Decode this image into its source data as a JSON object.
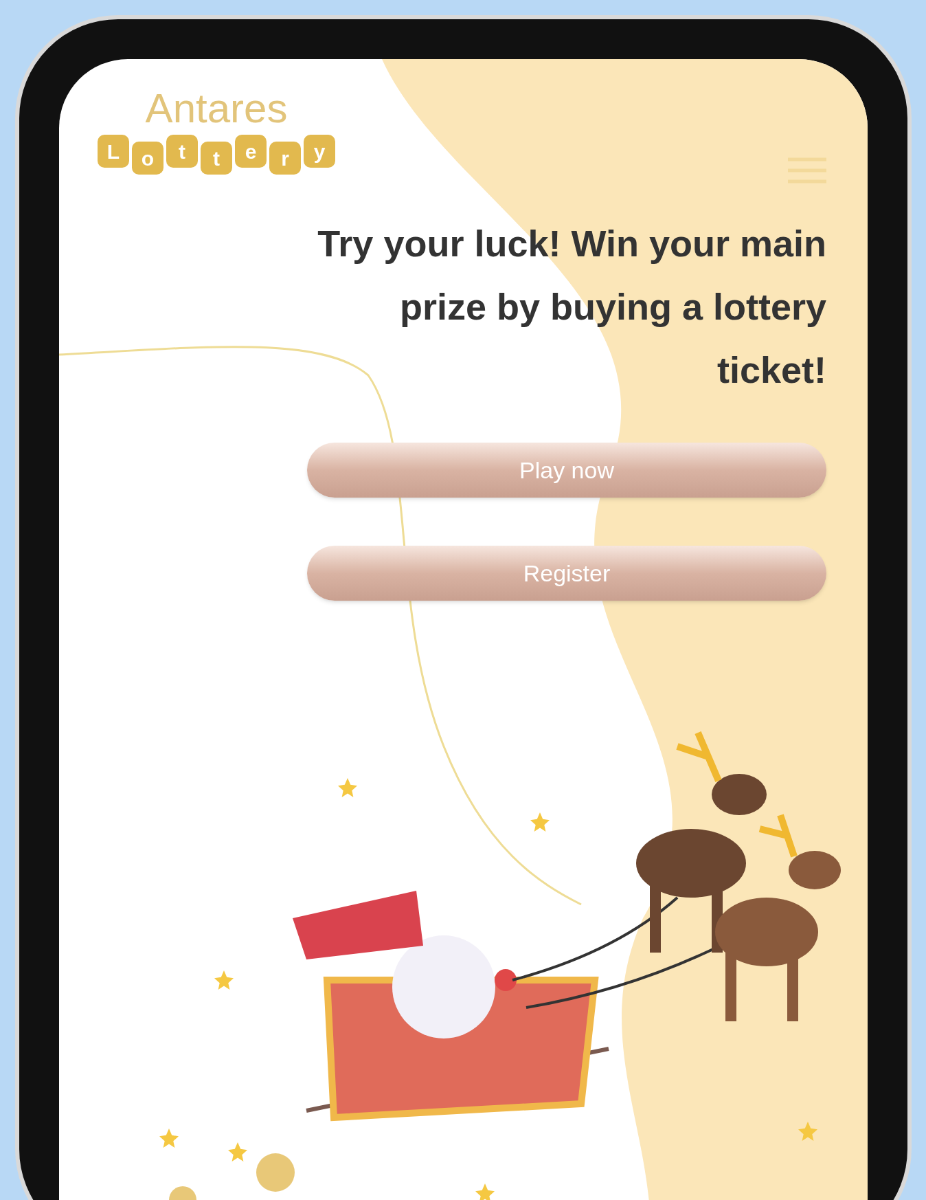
{
  "logo": {
    "name": "Antares",
    "tiles": [
      "L",
      "o",
      "t",
      "t",
      "e",
      "r",
      "y"
    ]
  },
  "hero": {
    "heading": "Try your luck! Win your main prize by buying a lottery ticket!"
  },
  "buttons": [
    {
      "label": "Play now"
    },
    {
      "label": "Register"
    }
  ]
}
